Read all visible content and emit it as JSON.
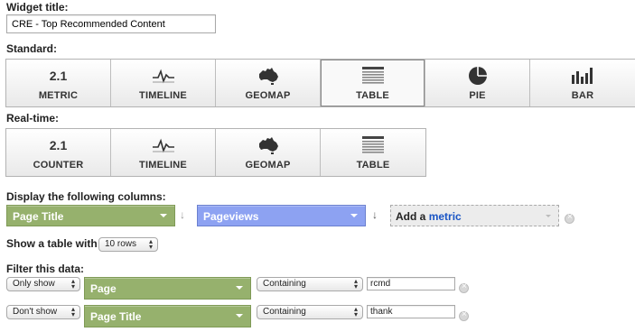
{
  "widget_title": {
    "label": "Widget title:",
    "value": "CRE - Top Recommended Content"
  },
  "standard": {
    "label": "Standard:",
    "buttons": [
      {
        "label": "METRIC",
        "icon_text": "2.1",
        "icon": "metric-number-icon",
        "selected": false
      },
      {
        "label": "TIMELINE",
        "icon": "timeline-icon",
        "selected": false
      },
      {
        "label": "GEOMAP",
        "icon": "australia-map-icon",
        "selected": false
      },
      {
        "label": "TABLE",
        "icon": "table-icon",
        "selected": true
      },
      {
        "label": "PIE",
        "icon": "pie-chart-icon",
        "selected": false
      },
      {
        "label": "BAR",
        "icon": "bar-chart-icon",
        "selected": false
      }
    ]
  },
  "realtime": {
    "label": "Real-time:",
    "buttons": [
      {
        "label": "COUNTER",
        "icon_text": "2.1",
        "icon": "counter-number-icon"
      },
      {
        "label": "TIMELINE",
        "icon": "timeline-icon"
      },
      {
        "label": "GEOMAP",
        "icon": "australia-map-icon"
      },
      {
        "label": "TABLE",
        "icon": "table-icon"
      }
    ]
  },
  "columns": {
    "label": "Display the following columns:",
    "dimension": "Page Title",
    "metric": "Pageviews",
    "add_prefix": "Add a",
    "add_link": "metric"
  },
  "table": {
    "label": "Show a table with",
    "rows_value": "10 rows"
  },
  "filter": {
    "label": "Filter this data:",
    "rows": [
      {
        "mode": "Only show",
        "dimension": "Page",
        "match": "Containing",
        "value": "rcmd"
      },
      {
        "mode": "Don't show",
        "dimension": "Page Title",
        "match": "Containing",
        "value": "thank"
      }
    ]
  },
  "colors": {
    "dimension_green": "#96b16d",
    "metric_blue": "#8da2f2",
    "link_blue": "#1a55c5"
  }
}
